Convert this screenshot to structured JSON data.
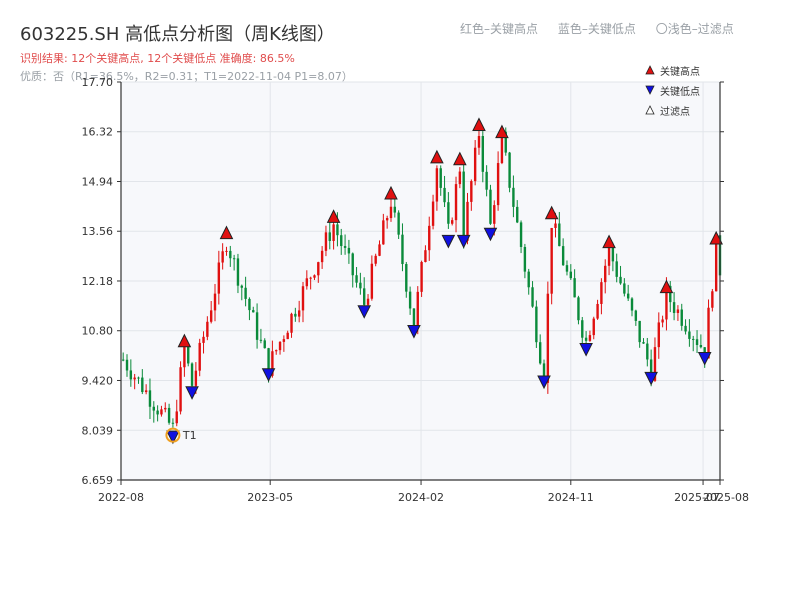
{
  "header": {
    "title": "603225.SH 高低点分析图（周K线图）",
    "result": "识别结果: 12个关键高点, 12个关键低点   准确度: 86.5%",
    "quality": "优质：否（R1=36.5%，R2=0.31；T1=2022-11-04 P1=8.07）"
  },
  "top_legend": {
    "red": "红色–关键高点",
    "blue": "蓝色–关键低点",
    "gray": "〇浅色–过滤点"
  },
  "chart_data": {
    "type": "candlestick",
    "title": "603225.SH 高低点分析图（周K线图）",
    "xlabel": "",
    "ylabel": "",
    "ylim": [
      6.659,
      17.7
    ],
    "y_ticks": [
      "6.659",
      "8.039",
      "9.420",
      "10.80",
      "12.18",
      "13.56",
      "14.94",
      "16.32",
      "17.70"
    ],
    "x_ticks": [
      "2022-08",
      "2023-05",
      "2024-02",
      "2024-11",
      "2025-07",
      "2025-08"
    ],
    "x_range": [
      "2022-08",
      "2025-08"
    ],
    "colors": {
      "up": "#e01010",
      "down": "#0a8a3a",
      "high": "#e01010",
      "low": "#1010e0"
    },
    "legend": {
      "high": "关键高点",
      "low": "关键低点",
      "filtered": "过滤点",
      "placement": "top-right"
    },
    "key_highs": [
      {
        "date": "2022-11-25",
        "price": 10.3
      },
      {
        "date": "2023-02-10",
        "price": 13.3
      },
      {
        "date": "2023-08-25",
        "price": 13.75
      },
      {
        "date": "2023-12-08",
        "price": 14.4
      },
      {
        "date": "2024-03-01",
        "price": 15.4
      },
      {
        "date": "2024-04-12",
        "price": 15.35
      },
      {
        "date": "2024-05-17",
        "price": 16.3
      },
      {
        "date": "2024-06-28",
        "price": 16.1
      },
      {
        "date": "2024-09-27",
        "price": 13.85
      },
      {
        "date": "2025-01-10",
        "price": 13.05
      },
      {
        "date": "2025-04-25",
        "price": 11.8
      },
      {
        "date": "2025-07-25",
        "price": 13.15
      }
    ],
    "key_lows": [
      {
        "date": "2022-11-04",
        "price": 8.07
      },
      {
        "date": "2022-12-09",
        "price": 9.3
      },
      {
        "date": "2023-04-28",
        "price": 9.8
      },
      {
        "date": "2023-10-20",
        "price": 11.55
      },
      {
        "date": "2024-01-19",
        "price": 11.0
      },
      {
        "date": "2024-03-22",
        "price": 13.5
      },
      {
        "date": "2024-04-19",
        "price": 13.5
      },
      {
        "date": "2024-06-07",
        "price": 13.7
      },
      {
        "date": "2024-09-13",
        "price": 9.6
      },
      {
        "date": "2024-11-29",
        "price": 10.5
      },
      {
        "date": "2025-03-28",
        "price": 9.7
      },
      {
        "date": "2025-07-04",
        "price": 10.25
      }
    ],
    "t1_marker": {
      "label": "T1",
      "date": "2022-11-04",
      "price": 8.07
    }
  }
}
